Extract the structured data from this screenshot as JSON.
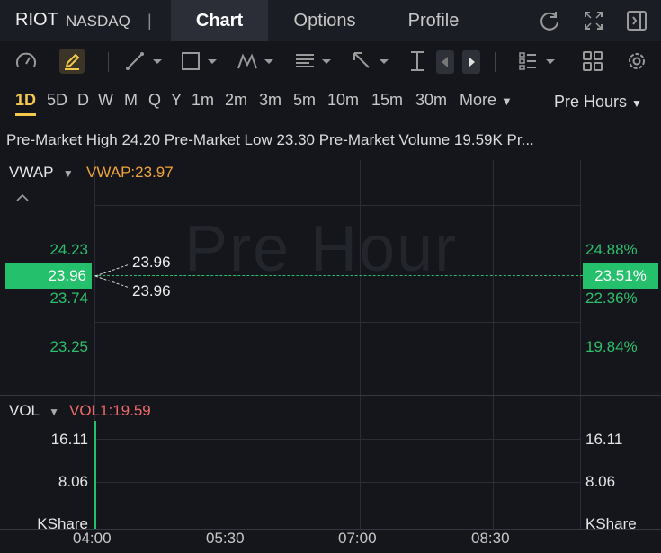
{
  "header": {
    "ticker": "RIOT",
    "exchange": "NASDAQ",
    "separator": "|",
    "tabs": [
      "Chart",
      "Options",
      "Profile"
    ],
    "icons": [
      "refresh-icon",
      "fullscreen-icon",
      "collapse-panel-icon"
    ]
  },
  "toolbar": {
    "icons": [
      "gauge-icon",
      "draw-pencil-icon",
      "line-tool-icon",
      "rectangle-tool-icon",
      "pattern-tool-icon",
      "text-tool-icon",
      "arrow-tool-icon",
      "measure-tool-icon",
      "step-back-icon",
      "step-forward-icon",
      "layout-list-icon",
      "grid-layout-icon",
      "settings-gear-icon"
    ]
  },
  "periods": [
    "1D",
    "5D",
    "D",
    "W",
    "M",
    "Q",
    "Y",
    "1m",
    "2m",
    "3m",
    "5m",
    "10m",
    "15m",
    "30m"
  ],
  "active_period": "1D",
  "more_label": "More",
  "session_label": "Pre Hours",
  "info_line": "Pre-Market High 24.20 Pre-Market Low 23.30 Pre-Market Volume 19.59K Pr...",
  "main_panel": {
    "indicator": "VWAP",
    "indicator_value": "VWAP:23.97",
    "watermark": "Pre Hour",
    "left_axis": [
      "24.23",
      "23.74",
      "23.25"
    ],
    "right_axis": [
      "24.88%",
      "22.36%",
      "19.84%"
    ],
    "current_price": "23.96",
    "current_change": "23.51%",
    "marker_high": "23.96",
    "marker_low": "23.96"
  },
  "volume_panel": {
    "indicator": "VOL",
    "indicator_value": "VOL1:19.59",
    "left_axis": [
      "16.11",
      "8.06",
      "KShare"
    ],
    "right_axis": [
      "16.11",
      "8.06",
      "KShare"
    ]
  },
  "time_axis": [
    "04:00",
    "05:30",
    "07:00",
    "08:30"
  ],
  "colors": {
    "accent": "#f2c94c",
    "up": "#24c06c",
    "vwap": "#f0a33a",
    "vol": "#f06a6a",
    "background": "#14161c"
  }
}
